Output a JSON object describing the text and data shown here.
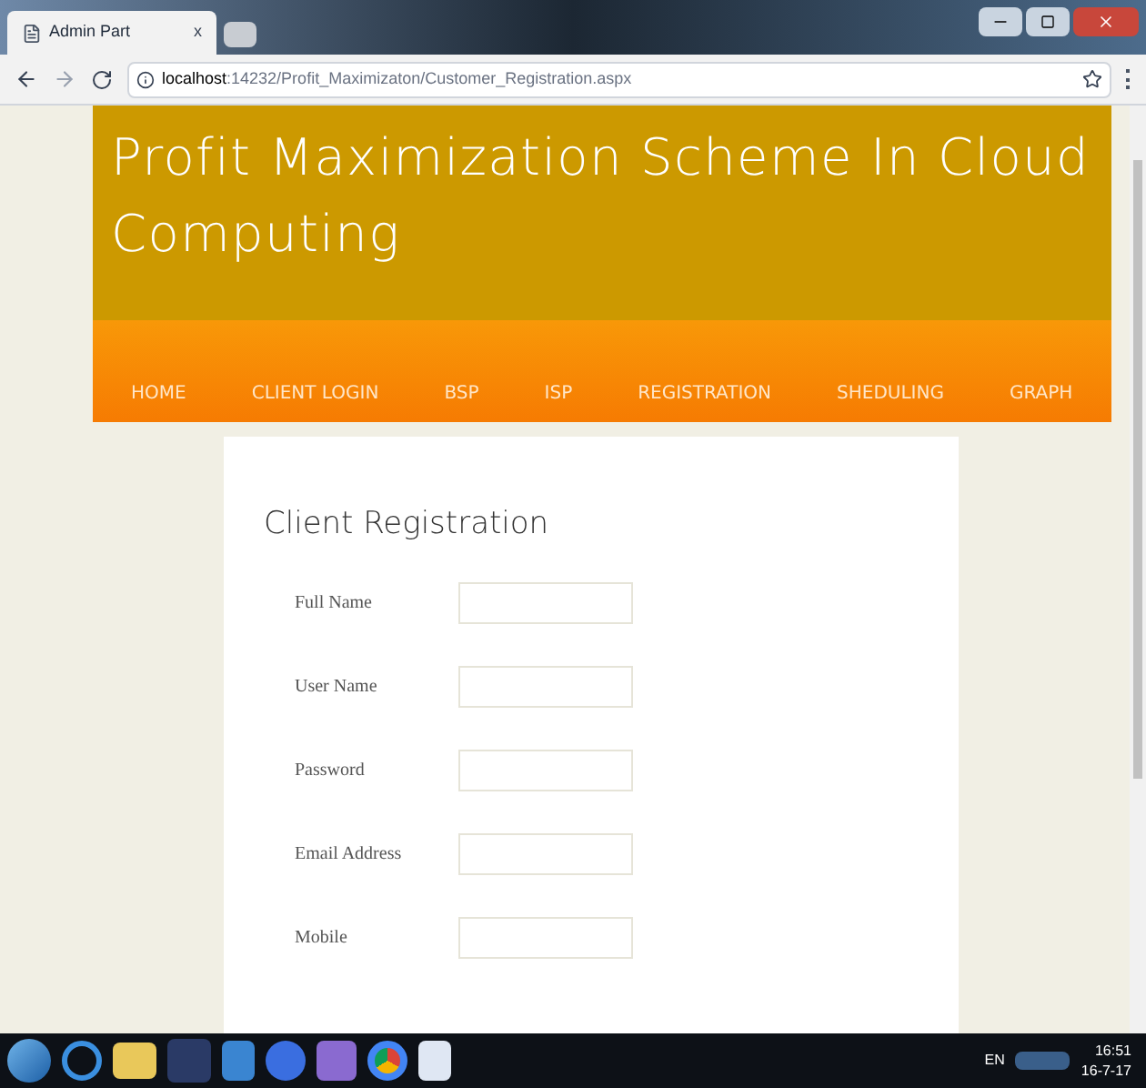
{
  "browser": {
    "tab_title": "Admin Part",
    "tab_close": "x",
    "url_host": "localhost",
    "url_path": ":14232/Profit_Maximizaton/Customer_Registration.aspx"
  },
  "header": {
    "title": "Profit Maximization Scheme In Cloud Computing"
  },
  "nav": [
    {
      "label": "HOME"
    },
    {
      "label": "CLIENT LOGIN"
    },
    {
      "label": "BSP"
    },
    {
      "label": "ISP"
    },
    {
      "label": "REGISTRATION"
    },
    {
      "label": "SHEDULING"
    },
    {
      "label": "GRAPH"
    }
  ],
  "form": {
    "title": "Client Registration",
    "fields": [
      {
        "label": "Full Name"
      },
      {
        "label": "User Name"
      },
      {
        "label": "Password"
      },
      {
        "label": "Email Address"
      },
      {
        "label": "Mobile"
      }
    ]
  },
  "taskbar": {
    "language": "EN",
    "time": "16:51",
    "date": "16-7-17"
  }
}
